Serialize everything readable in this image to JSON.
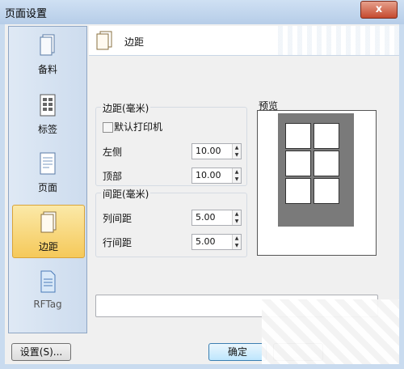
{
  "window": {
    "title": "页面设置",
    "close_glyph": "x"
  },
  "sidebar": {
    "items": [
      {
        "label": "备料",
        "icon": "page-stack-icon"
      },
      {
        "label": "标签",
        "icon": "label-sheet-icon"
      },
      {
        "label": "页面",
        "icon": "page-icon"
      },
      {
        "label": "边距",
        "icon": "margins-icon",
        "active": true
      },
      {
        "label": "RFTag",
        "icon": "rftag-icon"
      }
    ]
  },
  "header": {
    "title": "边距"
  },
  "margins": {
    "group_title": "边距(毫米)",
    "default_printer_label": "默认打印机",
    "default_printer_checked": false,
    "left_label": "左侧",
    "left_value": "10.00",
    "top_label": "顶部",
    "top_value": "10.00"
  },
  "spacing": {
    "group_title": "间距(毫米)",
    "col_label": "列间距",
    "col_value": "5.00",
    "row_label": "行间距",
    "row_value": "5.00"
  },
  "preview": {
    "title": "预览",
    "rows": 3,
    "cols": 2
  },
  "buttons": {
    "settings": "设置(S)...",
    "ok": "确定"
  },
  "colors": {
    "accent": "#f5c95a",
    "frame": "#c9dbef"
  }
}
